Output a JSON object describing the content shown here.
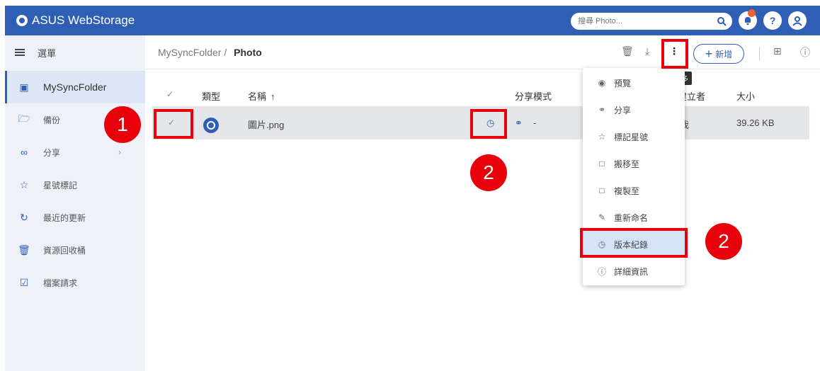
{
  "app": {
    "title": "ASUS WebStorage"
  },
  "search": {
    "placeholder": "搜尋 Photo..."
  },
  "sidebar": {
    "menu_label": "選單",
    "items": [
      {
        "label": "MySyncFolder",
        "icon": "folder-sync-icon"
      },
      {
        "label": "備份",
        "icon": "backup-folder-icon"
      },
      {
        "label": "分享",
        "icon": "share-people-icon"
      },
      {
        "label": "星號標記",
        "icon": "star-icon"
      },
      {
        "label": "最近的更新",
        "icon": "refresh-icon"
      },
      {
        "label": "資源回收桶",
        "icon": "trash-icon"
      },
      {
        "label": "檔案請求",
        "icon": "file-request-icon"
      }
    ]
  },
  "breadcrumb": {
    "root": "MySyncFolder",
    "separator": "/",
    "current": "Photo"
  },
  "toolbar": {
    "new_label": "新增",
    "more_tooltip": "顯示更多"
  },
  "table": {
    "headers": {
      "type": "類型",
      "name": "名稱",
      "share_mode": "分享模式",
      "creator": "建立者",
      "size": "大小"
    },
    "rows": [
      {
        "name": "圖片.png",
        "share": "-",
        "creator": "我",
        "size": "39.26 KB"
      }
    ]
  },
  "menu": {
    "items": [
      {
        "label": "預覽",
        "icon": "eye-icon"
      },
      {
        "label": "分享",
        "icon": "link-icon"
      },
      {
        "label": "標記星號",
        "icon": "star-icon"
      },
      {
        "label": "搬移至",
        "icon": "move-icon"
      },
      {
        "label": "複製至",
        "icon": "copy-icon"
      },
      {
        "label": "重新命名",
        "icon": "pencil-icon"
      },
      {
        "label": "版本紀錄",
        "icon": "history-icon"
      },
      {
        "label": "詳細資訊",
        "icon": "info-icon"
      }
    ]
  },
  "annotations": {
    "step1": "1",
    "step2a": "2",
    "step2b": "2"
  },
  "colors": {
    "brand": "#2f5fb4",
    "annotation": "#e8000b"
  }
}
